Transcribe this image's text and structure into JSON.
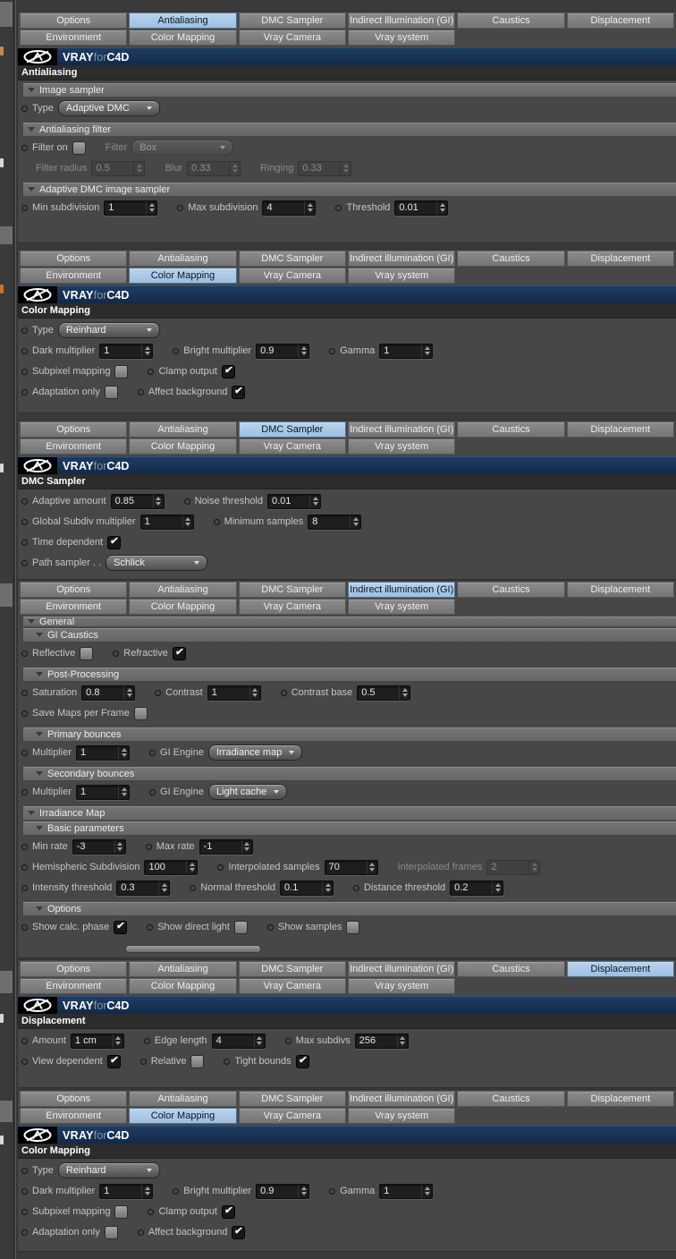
{
  "colors": {
    "selected_tab": "#a6c6e6",
    "logo_bar": "#16304f",
    "panel_bg": "#474747",
    "group_bar": "#6e6e6e",
    "section_title_bg": "#2c2c2c"
  },
  "icons": {
    "check": "✔"
  },
  "logo": {
    "brand": "VRAY",
    "mid": "for",
    "suffix": "C4D"
  },
  "tabs": {
    "row1": [
      "Options",
      "Antialiasing",
      "DMC Sampler",
      "Indirect illumination (GI)",
      "Caustics",
      "Displacement"
    ],
    "row2": [
      "Environment",
      "Color Mapping",
      "Vray Camera",
      "Vray system"
    ]
  },
  "sections": [
    {
      "selected_tab": "Antialiasing",
      "has_logo": true,
      "title": "Antialiasing",
      "rows": [
        {
          "t": "group",
          "label": "Image sampler"
        },
        {
          "t": "row",
          "items": [
            {
              "k": "dd",
              "label": "Type",
              "value": "Adaptive DMC"
            }
          ]
        },
        {
          "t": "group",
          "label": "Antialiasing filter"
        },
        {
          "t": "row",
          "items": [
            {
              "k": "cb",
              "label": "Filter on",
              "checked": false
            },
            {
              "k": "dd",
              "label": "Filter",
              "value": "Box",
              "disabled": true,
              "dot": false
            }
          ]
        },
        {
          "t": "row",
          "indent": true,
          "items": [
            {
              "k": "spin",
              "label": "Filter radius",
              "value": "0.5",
              "disabled": true,
              "dot": false
            },
            {
              "k": "spin",
              "label": "Blur",
              "value": "0.33",
              "disabled": true,
              "dot": false
            },
            {
              "k": "spin",
              "label": "Ringing",
              "value": "0.33",
              "disabled": true,
              "dot": false
            }
          ]
        },
        {
          "t": "group",
          "label": "Adaptive DMC image sampler"
        },
        {
          "t": "row",
          "items": [
            {
              "k": "spin",
              "label": "Min subdivision",
              "value": "1"
            },
            {
              "k": "spin",
              "label": "Max subdivision",
              "value": "4"
            },
            {
              "k": "spin",
              "label": "Threshold",
              "value": "0.01"
            }
          ]
        }
      ]
    },
    {
      "selected_tab": "Color Mapping",
      "has_logo": true,
      "title": "Color Mapping",
      "rows": [
        {
          "t": "row",
          "items": [
            {
              "k": "dd",
              "label": "Type",
              "value": "Reinhard"
            }
          ]
        },
        {
          "t": "row",
          "items": [
            {
              "k": "spin",
              "label": "Dark multiplier",
              "value": "1"
            },
            {
              "k": "spin",
              "label": "Bright multiplier",
              "value": "0.9"
            },
            {
              "k": "spin",
              "label": "Gamma",
              "value": "1"
            }
          ]
        },
        {
          "t": "row",
          "items": [
            {
              "k": "cb",
              "label": "Subpixel mapping",
              "checked": false
            },
            {
              "k": "cb",
              "label": "Clamp output",
              "checked": true
            }
          ]
        },
        {
          "t": "row",
          "items": [
            {
              "k": "cb",
              "label": "Adaptation only",
              "checked": false
            },
            {
              "k": "cb",
              "label": "Affect background",
              "checked": true
            }
          ]
        }
      ]
    },
    {
      "selected_tab": "DMC Sampler",
      "has_logo": true,
      "title": "DMC Sampler",
      "rows": [
        {
          "t": "row",
          "items": [
            {
              "k": "spin",
              "label": "Adaptive amount",
              "value": "0.85"
            },
            {
              "k": "spin",
              "label": "Noise threshold",
              "value": "0.01"
            }
          ]
        },
        {
          "t": "row",
          "items": [
            {
              "k": "spin",
              "label": "Global Subdiv multiplier",
              "value": "1"
            },
            {
              "k": "spin",
              "label": "Minimum samples",
              "value": "8"
            }
          ]
        },
        {
          "t": "row",
          "items": [
            {
              "k": "cb",
              "label": "Time dependent",
              "checked": true
            }
          ]
        },
        {
          "t": "row",
          "items": [
            {
              "k": "dd",
              "label": "Path sampler . .",
              "value": "Schlick"
            }
          ]
        }
      ]
    },
    {
      "selected_tab": "Indirect illumination (GI)",
      "has_logo": false,
      "title": "",
      "rows": [
        {
          "t": "group",
          "label": "General",
          "thin": true
        },
        {
          "t": "group",
          "label": "GI Caustics",
          "indent": true
        },
        {
          "t": "row",
          "items": [
            {
              "k": "cb",
              "label": "Reflective",
              "checked": false
            },
            {
              "k": "cb",
              "label": "Refractive",
              "checked": true
            }
          ]
        },
        {
          "t": "group",
          "label": "Post-Processing",
          "indent": true
        },
        {
          "t": "row",
          "items": [
            {
              "k": "spin",
              "label": "Saturation",
              "value": "0.8"
            },
            {
              "k": "spin",
              "label": "Contrast",
              "value": "1"
            },
            {
              "k": "spin",
              "label": "Contrast base",
              "value": "0.5"
            }
          ]
        },
        {
          "t": "row",
          "items": [
            {
              "k": "cb",
              "label": "Save Maps per Frame",
              "checked": false
            }
          ]
        },
        {
          "t": "group",
          "label": "Primary bounces",
          "indent": true
        },
        {
          "t": "row",
          "items": [
            {
              "k": "spin",
              "label": "Multiplier",
              "value": "1"
            },
            {
              "k": "dd",
              "label": "GI Engine",
              "value": "Irradiance map",
              "small": true
            }
          ]
        },
        {
          "t": "group",
          "label": "Secondary bounces",
          "indent": true
        },
        {
          "t": "row",
          "items": [
            {
              "k": "spin",
              "label": "Multiplier",
              "value": "1"
            },
            {
              "k": "dd",
              "label": "GI Engine",
              "value": "Light cache",
              "small": true
            }
          ]
        },
        {
          "t": "group",
          "label": "Irradiance Map"
        },
        {
          "t": "group",
          "label": "Basic parameters",
          "indent": true
        },
        {
          "t": "row",
          "items": [
            {
              "k": "spin",
              "label": "Min rate",
              "value": "-3"
            },
            {
              "k": "spin",
              "label": "Max rate",
              "value": "-1"
            }
          ]
        },
        {
          "t": "row",
          "items": [
            {
              "k": "spin",
              "label": "Hemispheric Subdivision",
              "value": "100"
            },
            {
              "k": "spin",
              "label": "Interpolated samples",
              "value": "70"
            },
            {
              "k": "spin",
              "label": "Interpolated frames",
              "value": "2",
              "disabled": true,
              "dot": false
            }
          ]
        },
        {
          "t": "row",
          "items": [
            {
              "k": "spin",
              "label": "Intensity threshold",
              "value": "0.3"
            },
            {
              "k": "spin",
              "label": "Normal threshold",
              "value": "0.1"
            },
            {
              "k": "spin",
              "label": "Distance threshold",
              "value": "0.2"
            }
          ]
        },
        {
          "t": "group",
          "label": "Options",
          "indent": true
        },
        {
          "t": "row",
          "items": [
            {
              "k": "cb",
              "label": "Show calc. phase",
              "checked": true
            },
            {
              "k": "cb",
              "label": "Show direct light",
              "checked": false
            },
            {
              "k": "cb",
              "label": "Show samples",
              "checked": false
            }
          ]
        },
        {
          "t": "scrollbar"
        }
      ]
    },
    {
      "selected_tab": "Displacement",
      "has_logo": true,
      "title": "Displacement",
      "rows": [
        {
          "t": "row",
          "items": [
            {
              "k": "spin",
              "label": "Amount",
              "value": "1 cm"
            },
            {
              "k": "spin",
              "label": "Edge length",
              "value": "4"
            },
            {
              "k": "spin",
              "label": "Max subdivs",
              "value": "256"
            }
          ]
        },
        {
          "t": "row",
          "items": [
            {
              "k": "cb",
              "label": "View dependent",
              "checked": true
            },
            {
              "k": "cb",
              "label": "Relative",
              "checked": false
            },
            {
              "k": "cb",
              "label": "Tight bounds",
              "checked": true
            }
          ]
        }
      ]
    },
    {
      "selected_tab": "Color Mapping",
      "has_logo": true,
      "title": "Color Mapping",
      "rows": [
        {
          "t": "row",
          "items": [
            {
              "k": "dd",
              "label": "Type",
              "value": "Reinhard"
            }
          ]
        },
        {
          "t": "row",
          "items": [
            {
              "k": "spin",
              "label": "Dark multiplier",
              "value": "1"
            },
            {
              "k": "spin",
              "label": "Bright multiplier",
              "value": "0.9"
            },
            {
              "k": "spin",
              "label": "Gamma",
              "value": "1"
            }
          ]
        },
        {
          "t": "row",
          "items": [
            {
              "k": "cb",
              "label": "Subpixel mapping",
              "checked": false
            },
            {
              "k": "cb",
              "label": "Clamp output",
              "checked": true
            }
          ]
        },
        {
          "t": "row",
          "items": [
            {
              "k": "cb",
              "label": "Adaptation only",
              "checked": false
            },
            {
              "k": "cb",
              "label": "Affect background",
              "checked": true
            }
          ]
        }
      ]
    }
  ]
}
